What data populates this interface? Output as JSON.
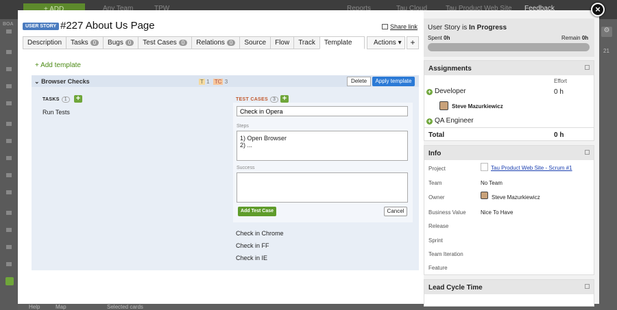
{
  "background": {
    "add_label": "+ ADD",
    "top_texts": [
      "Any Team",
      "TPW",
      "Reports",
      "Tau Cloud",
      "Tau Product Web Site",
      "Feedback"
    ],
    "board_label": "BOA",
    "bottom": [
      "Help",
      "Map",
      "Selected cards"
    ],
    "right_count": "21"
  },
  "story": {
    "badge": "USER STORY",
    "id": "#227",
    "title": "About Us Page",
    "share": "Share link"
  },
  "tabs": [
    {
      "label": "Description",
      "count": null
    },
    {
      "label": "Tasks",
      "count": "0"
    },
    {
      "label": "Bugs",
      "count": "0"
    },
    {
      "label": "Test Cases",
      "count": "0"
    },
    {
      "label": "Relations",
      "count": "0"
    },
    {
      "label": "Source",
      "count": null
    },
    {
      "label": "Flow",
      "count": null
    },
    {
      "label": "Track",
      "count": null
    },
    {
      "label": "Template",
      "count": null,
      "active": true
    }
  ],
  "actions_label": "Actions",
  "add_tab_label": "+",
  "add_template": "+ Add template",
  "template": {
    "name": "Browser Checks",
    "t_label": "T",
    "t_count": "1",
    "tc_label": "TC",
    "tc_count": "3",
    "delete": "Delete",
    "apply": "Apply template",
    "tasks_label": "TASKS",
    "tasks_count": "1",
    "tasks": [
      "Run Tests"
    ],
    "tc_label_full": "TEST CASES",
    "tc_count_full": "3",
    "edit": {
      "name": "Check in Opera",
      "steps_label": "Steps",
      "steps": "1) Open Browser\n2) ...",
      "success_label": "Success",
      "success": "",
      "add_button": "Add Test Case",
      "cancel": "Cancel"
    },
    "test_cases": [
      "Check in Chrome",
      "Check in FF",
      "Check in IE"
    ]
  },
  "status": {
    "prefix": "User Story is",
    "state": "In Progress",
    "spent_label": "Spent",
    "spent": "0h",
    "remain_label": "Remain",
    "remain": "0h"
  },
  "assignments": {
    "title": "Assignments",
    "effort_label": "Effort",
    "roles": [
      {
        "role": "Developer",
        "effort": "0 h",
        "person": "Steve Mazurkiewicz"
      },
      {
        "role": "QA Engineer"
      }
    ],
    "total_label": "Total",
    "total": "0 h"
  },
  "info": {
    "title": "Info",
    "rows": [
      {
        "label": "Project",
        "value": "Tau Product Web Site - Scrum #1"
      },
      {
        "label": "Team",
        "value": "No Team"
      },
      {
        "label": "Owner",
        "value": "Steve Mazurkiewicz"
      },
      {
        "label": "Business Value",
        "value": "Nice To Have"
      },
      {
        "label": "Release",
        "value": ""
      },
      {
        "label": "Sprint",
        "value": ""
      },
      {
        "label": "Team Iteration",
        "value": ""
      },
      {
        "label": "Feature",
        "value": ""
      }
    ]
  },
  "lead_cycle": {
    "title": "Lead Cycle Time"
  },
  "colors": {
    "accent": "#2b7ad6",
    "green": "#6fa63a",
    "badge": "#4a7bbf"
  }
}
